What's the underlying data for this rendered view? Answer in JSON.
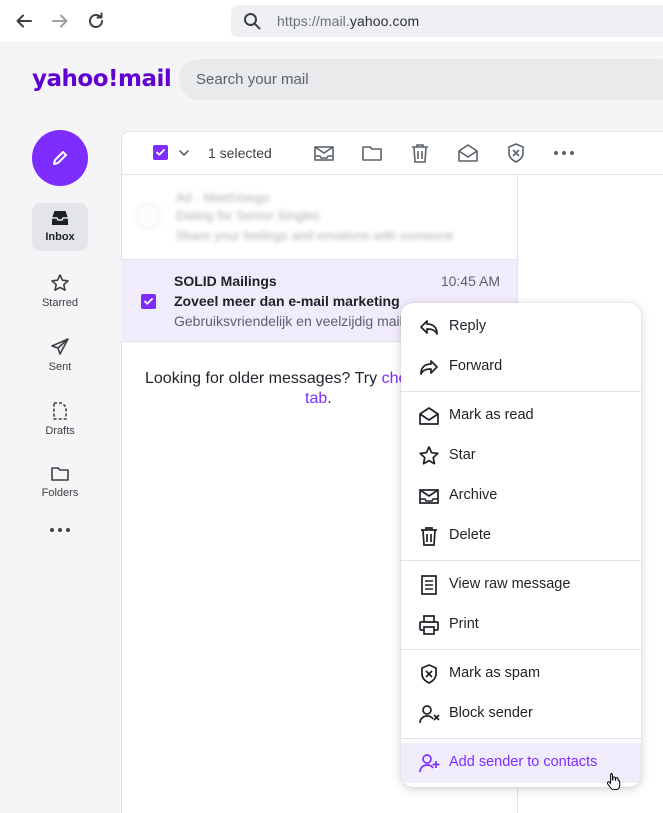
{
  "browser": {
    "url_prefix": "https://mail.",
    "url_host": "yahoo.com"
  },
  "header": {
    "logo": "yahoo!mail",
    "search_placeholder": "Search your mail"
  },
  "rail": {
    "items": [
      {
        "label": "Inbox",
        "icon": "inbox-icon",
        "active": true
      },
      {
        "label": "Starred",
        "icon": "star-icon"
      },
      {
        "label": "Sent",
        "icon": "send-icon"
      },
      {
        "label": "Drafts",
        "icon": "draft-icon"
      },
      {
        "label": "Folders",
        "icon": "folder-icon"
      }
    ]
  },
  "toolbar": {
    "selected_label": "1 selected"
  },
  "ad": {
    "line1": "Ad · MeetVoego",
    "line2": "Dating for Senior Singles",
    "line3": "Share your feelings and emotions with someone"
  },
  "message": {
    "sender": "SOLID Mailings",
    "time": "10:45 AM",
    "subject": "Zoveel meer dan e-mail marketing",
    "snippet": "Gebruiksvriendelijk en veelzijdig mail"
  },
  "older": {
    "text": "Looking for older messages? Try ",
    "link1": "che",
    "link2": "tab",
    "end": "."
  },
  "context_menu": {
    "items": [
      {
        "label": "Reply",
        "icon": "reply-icon"
      },
      {
        "label": "Forward",
        "icon": "forward-icon"
      },
      {
        "label": "Mark as read",
        "icon": "envelope-open-icon"
      },
      {
        "label": "Star",
        "icon": "star-icon"
      },
      {
        "label": "Archive",
        "icon": "archive-icon"
      },
      {
        "label": "Delete",
        "icon": "trash-icon"
      },
      {
        "label": "View raw message",
        "icon": "document-icon"
      },
      {
        "label": "Print",
        "icon": "printer-icon"
      },
      {
        "label": "Mark as spam",
        "icon": "spam-shield-icon"
      },
      {
        "label": "Block sender",
        "icon": "block-user-icon"
      },
      {
        "label": "Add sender to contacts",
        "icon": "add-user-icon",
        "highlighted": true
      }
    ]
  },
  "colors": {
    "accent": "#7d2eff",
    "brand": "#6001d2",
    "selected_row": "#f1ecfc"
  }
}
